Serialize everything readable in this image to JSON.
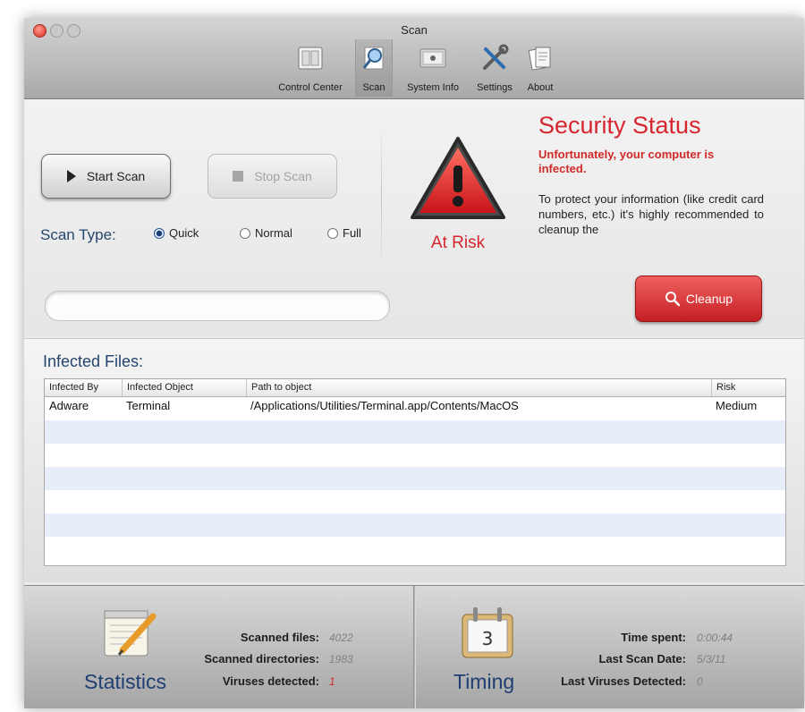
{
  "window": {
    "title": "Scan"
  },
  "toolbar": {
    "items": [
      {
        "label": "Control Center",
        "icon": "control-center-icon"
      },
      {
        "label": "Scan",
        "icon": "scan-icon"
      },
      {
        "label": "System Info",
        "icon": "system-info-icon"
      },
      {
        "label": "Settings",
        "icon": "settings-icon"
      },
      {
        "label": "About",
        "icon": "about-icon"
      }
    ],
    "selected": "Scan"
  },
  "scan": {
    "start_label": "Start Scan",
    "stop_label": "Stop Scan",
    "type_label": "Scan Type:",
    "types": [
      "Quick",
      "Normal",
      "Full"
    ],
    "selected_type": "Quick",
    "progress": 0
  },
  "status": {
    "badge": "At Risk",
    "title": "Security Status",
    "subtitle": "Unfortunately, your computer is infected.",
    "body": "To protect your information (like credit card numbers, etc.) it's highly recommended to cleanup the",
    "cleanup_label": "Cleanup"
  },
  "infected": {
    "title": "Infected Files:",
    "columns": [
      "Infected By",
      "Infected Object",
      "Path to object",
      "Risk"
    ],
    "rows": [
      [
        "Adware",
        "Terminal",
        "/Applications/Utilities/Terminal.app/Contents/MacOS",
        "Medium"
      ]
    ]
  },
  "statistics": {
    "title": "Statistics",
    "scanned_files_label": "Scanned files:",
    "scanned_files": "4022",
    "scanned_dirs_label": "Scanned directories:",
    "scanned_dirs": "1983",
    "viruses_label": "Viruses detected:",
    "viruses": "1"
  },
  "timing": {
    "title": "Timing",
    "time_spent_label": "Time spent:",
    "time_spent": "0:00:44",
    "last_scan_label": "Last Scan Date:",
    "last_scan": "5/3/11",
    "last_viruses_label": "Last Viruses Detected:",
    "last_viruses": "0",
    "calendar_day": "3"
  },
  "colors": {
    "accent_blue": "#26456e",
    "danger_red": "#d6262f"
  }
}
